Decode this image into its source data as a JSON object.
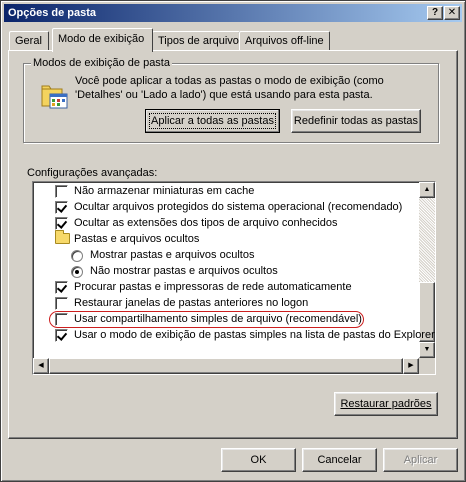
{
  "window": {
    "title": "Opções de pasta",
    "help_glyph": "?",
    "close_glyph": "✕"
  },
  "tabs": [
    {
      "label": "Geral",
      "active": false
    },
    {
      "label": "Modo de exibição",
      "active": true
    },
    {
      "label": "Tipos de arquivo",
      "active": false
    },
    {
      "label": "Arquivos off-line",
      "active": false
    }
  ],
  "folder_views": {
    "legend": "Modos de exibição de pasta",
    "description": "Você pode aplicar a todas as pastas o modo de exibição (como 'Detalhes' ou 'Lado a lado') que está usando para esta pasta.",
    "apply_all_label": "Aplicar a todas as pastas",
    "reset_all_label": "Redefinir todas as pastas"
  },
  "advanced": {
    "label": "Configurações avançadas:",
    "items": [
      {
        "type": "checkbox",
        "checked": false,
        "indent": 0,
        "label": "Não armazenar miniaturas em cache"
      },
      {
        "type": "checkbox",
        "checked": true,
        "indent": 0,
        "label": "Ocultar arquivos protegidos do sistema operacional (recomendado)"
      },
      {
        "type": "checkbox",
        "checked": true,
        "indent": 0,
        "label": "Ocultar as extensões dos tipos de arquivo conhecidos"
      },
      {
        "type": "folder",
        "indent": 0,
        "label": "Pastas e arquivos ocultos"
      },
      {
        "type": "radio",
        "checked": false,
        "indent": 1,
        "label": "Mostrar pastas e arquivos ocultos"
      },
      {
        "type": "radio",
        "checked": true,
        "indent": 1,
        "label": "Não mostrar pastas e arquivos ocultos"
      },
      {
        "type": "checkbox",
        "checked": true,
        "indent": 0,
        "label": "Procurar pastas e impressoras de rede automaticamente"
      },
      {
        "type": "checkbox",
        "checked": false,
        "indent": 0,
        "label": "Restaurar janelas de pastas anteriores no logon"
      },
      {
        "type": "checkbox",
        "checked": false,
        "indent": 0,
        "label": "Usar compartilhamento simples de arquivo (recomendável)",
        "highlighted": true
      },
      {
        "type": "checkbox",
        "checked": true,
        "indent": 0,
        "label": "Usar o modo de exibição de pastas simples na lista de pastas do Explorer"
      }
    ]
  },
  "restore_defaults_label": "Restaurar padrões",
  "footer": {
    "ok_label": "OK",
    "cancel_label": "Cancelar",
    "apply_label": "Aplicar"
  },
  "colors": {
    "title_gradient_start": "#0a246a",
    "title_gradient_end": "#a6caf0",
    "highlight_ring": "#cc1f1f",
    "dialog_face": "#d4d0c8"
  }
}
